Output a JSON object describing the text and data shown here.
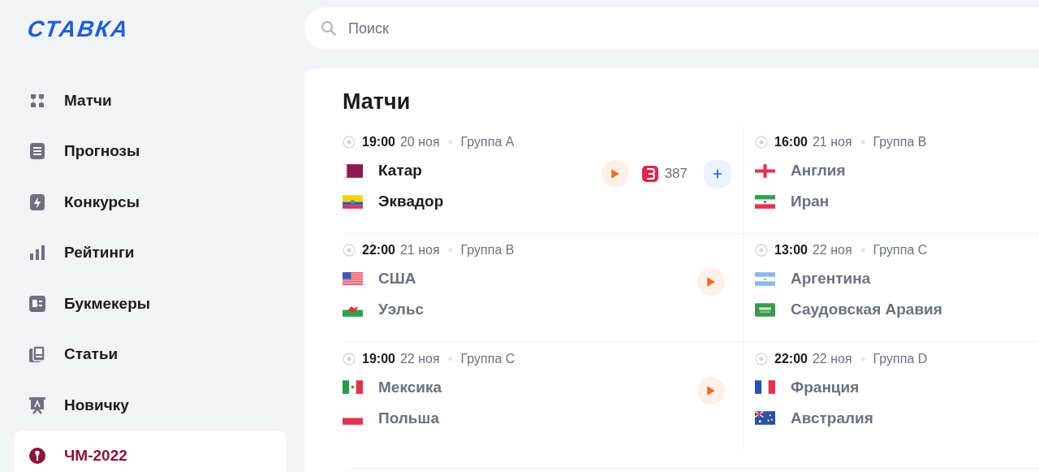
{
  "logo": "СТАВКА",
  "search": {
    "placeholder": "Поиск"
  },
  "sidebar": {
    "items": [
      {
        "label": "Матчи",
        "selected": false
      },
      {
        "label": "Прогнозы",
        "selected": false
      },
      {
        "label": "Конкурсы",
        "selected": false
      },
      {
        "label": "Рейтинги",
        "selected": false
      },
      {
        "label": "Букмекеры",
        "selected": false
      },
      {
        "label": "Статьи",
        "selected": false
      },
      {
        "label": "Новичку",
        "selected": false
      },
      {
        "label": "ЧМ-2022",
        "selected": true
      }
    ]
  },
  "title": "Матчи",
  "matches": [
    {
      "time": "19:00",
      "date": "20 ноя",
      "group": "Группа A",
      "teams": [
        "Катар",
        "Эквадор"
      ],
      "highlighted": true,
      "video": true,
      "bets": "387",
      "add": true
    },
    {
      "time": "16:00",
      "date": "21 ноя",
      "group": "Группа B",
      "teams": [
        "Англия",
        "Иран"
      ],
      "highlighted": false,
      "video": false,
      "add": false
    },
    {
      "time": "22:00",
      "date": "21 ноя",
      "group": "Группа B",
      "teams": [
        "США",
        "Уэльс"
      ],
      "highlighted": false,
      "video": true,
      "add": false
    },
    {
      "time": "13:00",
      "date": "22 ноя",
      "group": "Группа C",
      "teams": [
        "Аргентина",
        "Саудовская Аравия"
      ],
      "highlighted": false,
      "video": false,
      "add": false
    },
    {
      "time": "19:00",
      "date": "22 ноя",
      "group": "Группа C",
      "teams": [
        "Мексика",
        "Польша"
      ],
      "highlighted": false,
      "video": true,
      "add": false
    },
    {
      "time": "22:00",
      "date": "22 ноя",
      "group": "Группа D",
      "teams": [
        "Франция",
        "Австралия"
      ],
      "highlighted": false,
      "video": false,
      "add": false
    }
  ]
}
